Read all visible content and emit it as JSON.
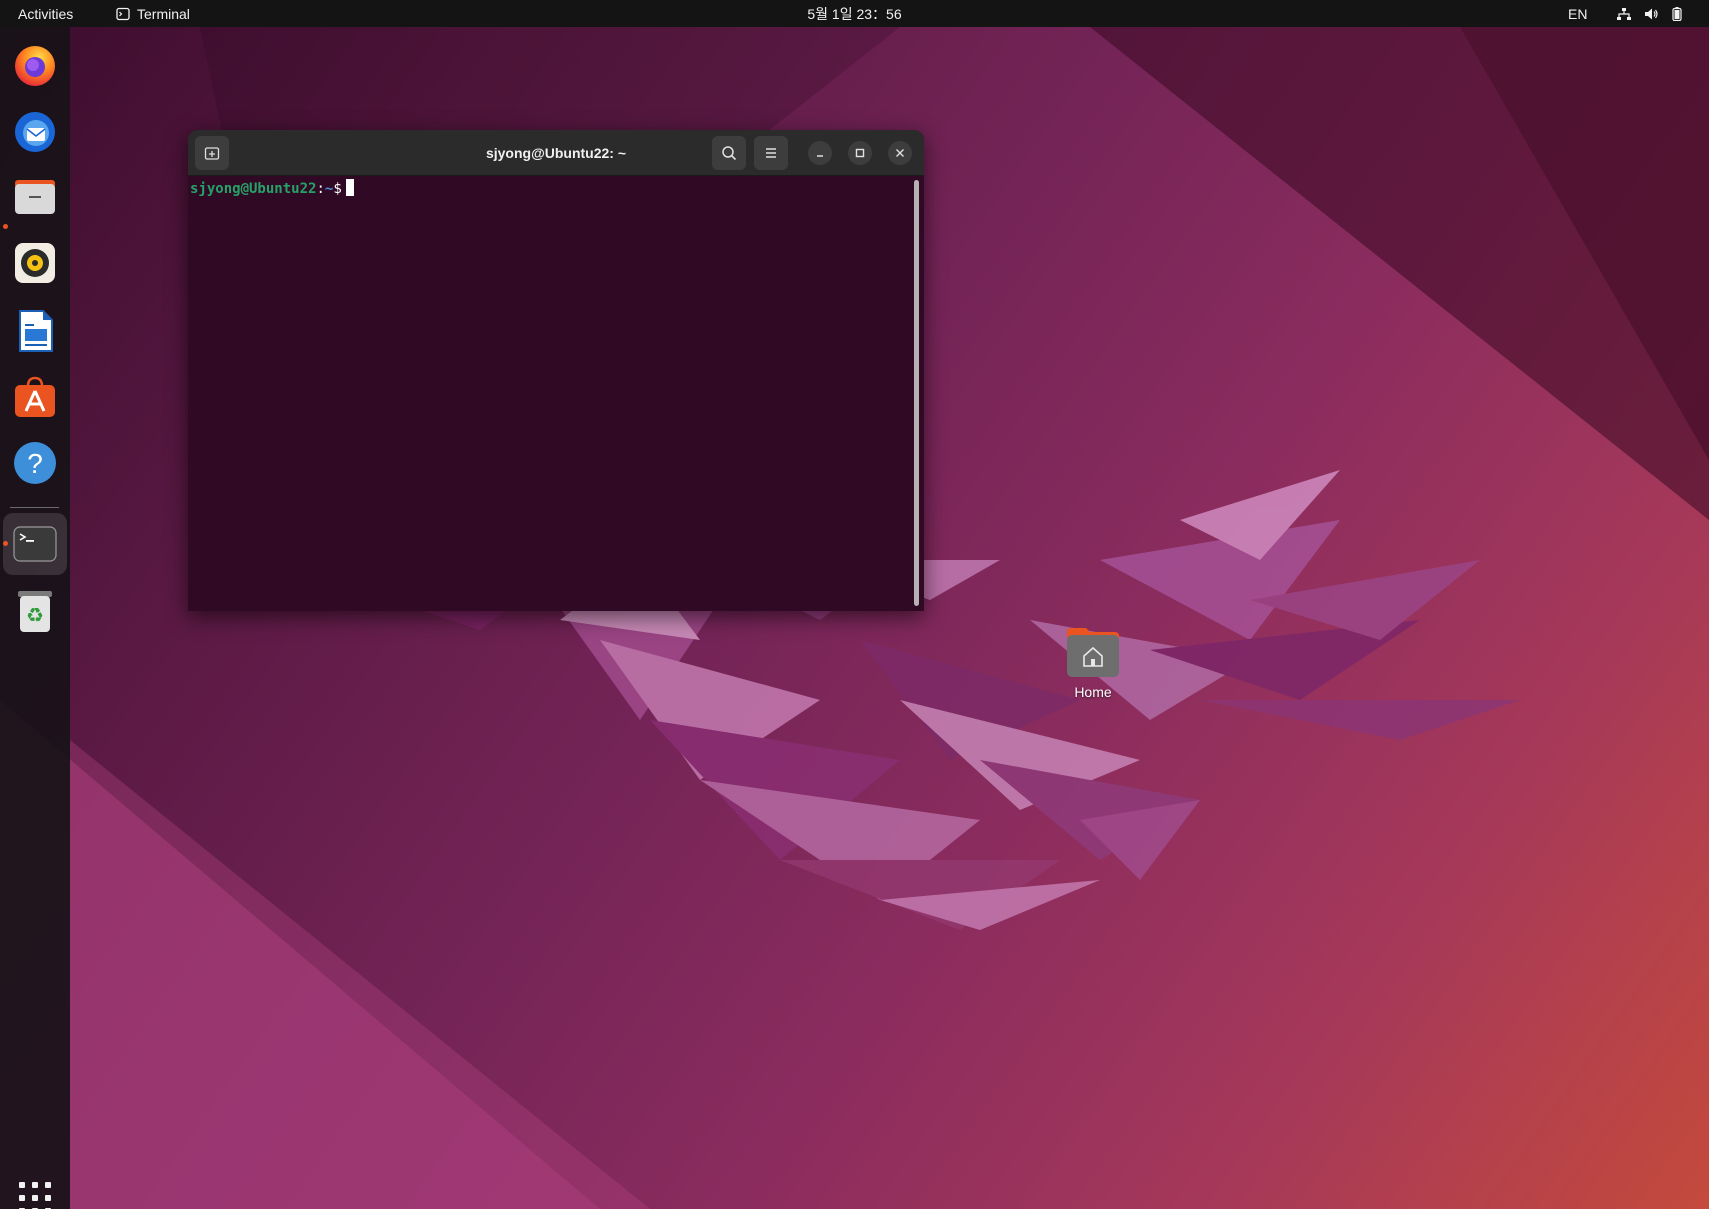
{
  "topbar": {
    "activities": "Activities",
    "app_name": "Terminal",
    "clock": "5월 1일  23：56",
    "input_lang": "EN"
  },
  "dock": {
    "items": [
      {
        "name": "Firefox",
        "icon": "firefox-icon",
        "running": false
      },
      {
        "name": "Thunderbird Mail",
        "icon": "thunderbird-icon",
        "running": false
      },
      {
        "name": "Files",
        "icon": "files-icon",
        "running": true
      },
      {
        "name": "Rhythmbox",
        "icon": "rhythmbox-icon",
        "running": false
      },
      {
        "name": "LibreOffice Writer",
        "icon": "writer-icon",
        "running": false
      },
      {
        "name": "Ubuntu Software",
        "icon": "software-icon",
        "running": false
      },
      {
        "name": "Help",
        "icon": "help-icon",
        "running": false
      },
      {
        "name": "Terminal",
        "icon": "terminal-icon",
        "running": true,
        "active": true
      },
      {
        "name": "Trash",
        "icon": "trash-icon",
        "running": false
      }
    ],
    "show_apps_icon": "app-grid-icon"
  },
  "desktop": {
    "home_label": "Home"
  },
  "terminal": {
    "title": "sjyong@Ubuntu22: ~",
    "prompt_user": "sjyong@Ubuntu22",
    "prompt_sep": ":",
    "prompt_path": "~",
    "prompt_symbol": "$"
  },
  "colors": {
    "accent": "#e95420",
    "terminal_bg": "#300a24",
    "prompt_user": "#26a269",
    "prompt_path": "#4e8ad8",
    "topbar_bg": "#141414"
  }
}
